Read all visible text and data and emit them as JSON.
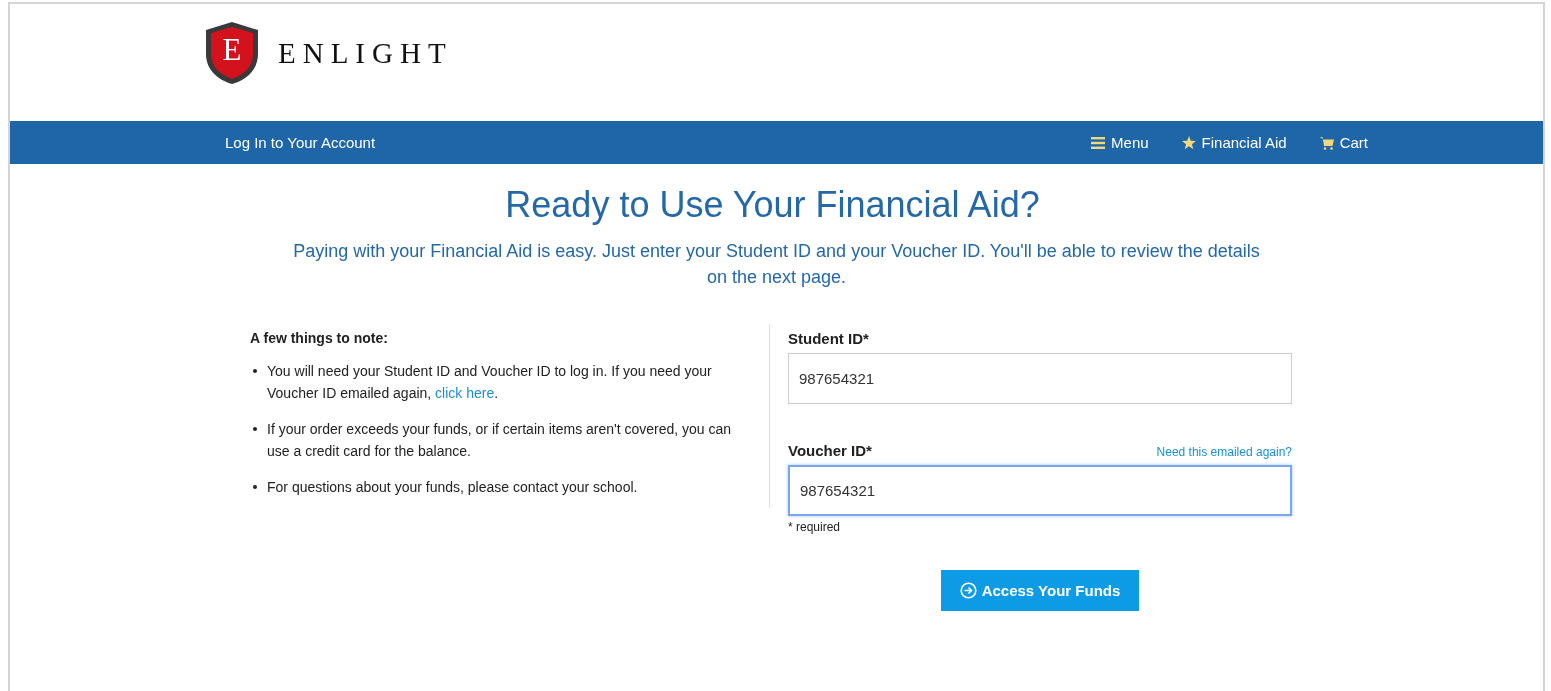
{
  "brand": {
    "logo_letter": "E",
    "name": "ENLIGHT"
  },
  "nav": {
    "title": "Log In to Your Account",
    "items": [
      {
        "kind": "menu",
        "label": "Menu"
      },
      {
        "kind": "star",
        "label": "Financial Aid"
      },
      {
        "kind": "cart",
        "label": "Cart"
      }
    ]
  },
  "heading": "Ready to Use Your Financial Aid?",
  "intro": "Paying with your Financial Aid is easy. Just enter your Student ID and your Voucher ID. You'll be able to review the details on the next page.",
  "notes": {
    "title": "A few things to note:",
    "items": [
      {
        "text": "You will need your Student ID and Voucher ID to log in. If you need your Voucher ID emailed again, ",
        "link": "click here",
        "after": "."
      },
      {
        "text": "If your order exceeds your funds, or if certain items aren't covered, you can use a credit card for the balance."
      },
      {
        "text": "For questions about your funds, please contact your school."
      }
    ]
  },
  "form": {
    "fields": [
      {
        "label": "Student ID*",
        "value": "987654321",
        "focused": false
      },
      {
        "label": "Voucher ID*",
        "value": "987654321",
        "focused": true,
        "help_link": "Need this emailed again?"
      }
    ],
    "required_note": "* required",
    "submit": "Access Your Funds"
  }
}
